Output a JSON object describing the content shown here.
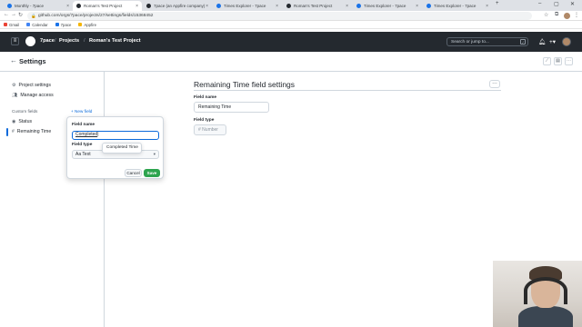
{
  "browser": {
    "tabs": [
      {
        "label": "Monthly - 7pace",
        "active": false,
        "color": "#1a73e8"
      },
      {
        "label": "Roman's Test Project",
        "active": true,
        "color": "#24292f"
      },
      {
        "label": "7pace (an Appfire company)",
        "active": false,
        "color": "#24292f"
      },
      {
        "label": "Times Explorer - 7pace",
        "active": false,
        "color": "#1a73e8"
      },
      {
        "label": "Roman's Test Project",
        "active": false,
        "color": "#24292f"
      },
      {
        "label": "Times Explorer - 7pace",
        "active": false,
        "color": "#1a73e8"
      },
      {
        "label": "Times Explorer - 7pace",
        "active": false,
        "color": "#1a73e8"
      }
    ],
    "url": "github.com/orgs/7pace/projects/27/settings/fields/15368452",
    "bookmarks": [
      {
        "label": "Gmail",
        "color": "#ea4335"
      },
      {
        "label": "Calendar",
        "color": "#4285f4"
      },
      {
        "label": "7pace",
        "color": "#1a73e8"
      },
      {
        "label": "Appfire",
        "color": "#f4b400"
      }
    ]
  },
  "github": {
    "org": "7pace",
    "projects": "Projects",
    "project_name": "Roman's Test Project",
    "search_placeholder": "Search or jump to...",
    "search_key": "/"
  },
  "settings": {
    "title": "Settings",
    "sidebar": {
      "items": [
        {
          "label": "Project settings",
          "icon": "gear-icon"
        },
        {
          "label": "Manage access",
          "icon": "people-icon"
        }
      ],
      "custom_fields_label": "Custom fields",
      "new_field": "+ New field",
      "fields": [
        {
          "label": "Status",
          "icon": "single-select-icon"
        },
        {
          "label": "Remaining Time",
          "icon": "number-icon",
          "selected": true
        }
      ]
    },
    "popover": {
      "name_label": "Field name",
      "name_value": "Completed",
      "type_label": "Field type",
      "type_value": "Aa Text",
      "cancel": "Cancel",
      "save": "Save"
    },
    "autocomplete": "Completed Time",
    "main": {
      "title": "Remaining Time field settings",
      "name_label": "Field name",
      "name_value": "Remaining Time",
      "type_label": "Field type",
      "type_value": "Number"
    }
  }
}
